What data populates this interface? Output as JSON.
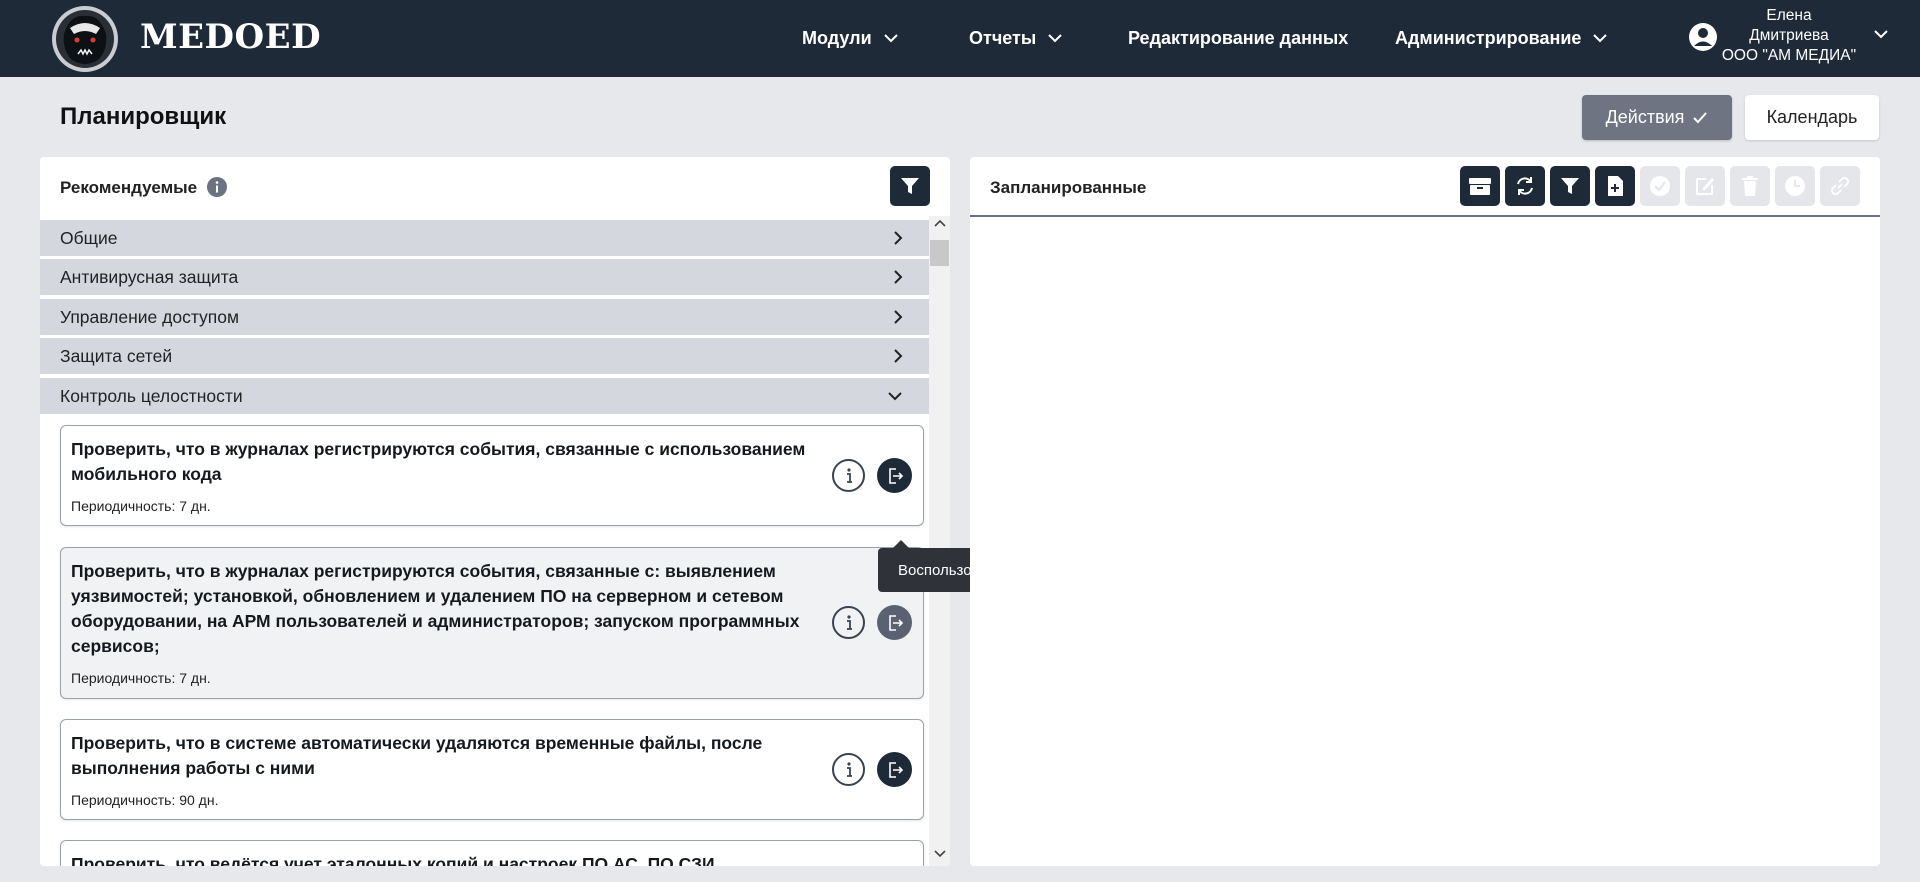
{
  "header": {
    "brand": "MEDOED",
    "nav": [
      {
        "label": "Модули",
        "has_dropdown": true
      },
      {
        "label": "Отчеты",
        "has_dropdown": true
      },
      {
        "label": "Редактирование данных",
        "has_dropdown": false
      },
      {
        "label": "Администрирование",
        "has_dropdown": true
      }
    ],
    "user": {
      "first_name": "Елена",
      "last_name": "Дмитриева",
      "org": "ООО \"АМ МЕДИА\""
    }
  },
  "page": {
    "title": "Планировщик",
    "actions_label": "Действия",
    "calendar_label": "Календарь"
  },
  "recommended": {
    "title": "Рекомендуемые",
    "categories": [
      {
        "label": "Общие",
        "expanded": false
      },
      {
        "label": "Антивирусная защита",
        "expanded": false
      },
      {
        "label": "Управление доступом",
        "expanded": false
      },
      {
        "label": "Защита сетей",
        "expanded": false
      },
      {
        "label": "Контроль целостности",
        "expanded": true
      }
    ],
    "items": [
      {
        "title": "Проверить, что в журналах регистрируются события, связанные с использованием мобильного кода",
        "period": "Периодичность: 7 дн."
      },
      {
        "title": "Проверить, что в журналах регистрируются события, связанные с: выявлением уязвимостей; установкой, обновлением и удалением ПО на серверном и сетевом оборудовании, на АРМ пользователей и администраторов; запуском программных сервисов;",
        "period": "Периодичность: 7 дн."
      },
      {
        "title": "Проверить, что в системе автоматически удаляются временные файлы, после выполнения работы с ними",
        "period": "Периодичность: 90 дн."
      },
      {
        "title": "Проверить, что ведётся учет эталонных копий и настроек ПО АС, ПО СЗИ, системного"
      }
    ],
    "tooltip": "Воспользоваться рекомендацией"
  },
  "scheduled": {
    "title": "Запланированные"
  },
  "colors": {
    "header_bg": "#1e2a38",
    "page_bg": "#e6e8ec",
    "category_bg": "#d4d8de",
    "actions_bg": "#6e7481"
  }
}
